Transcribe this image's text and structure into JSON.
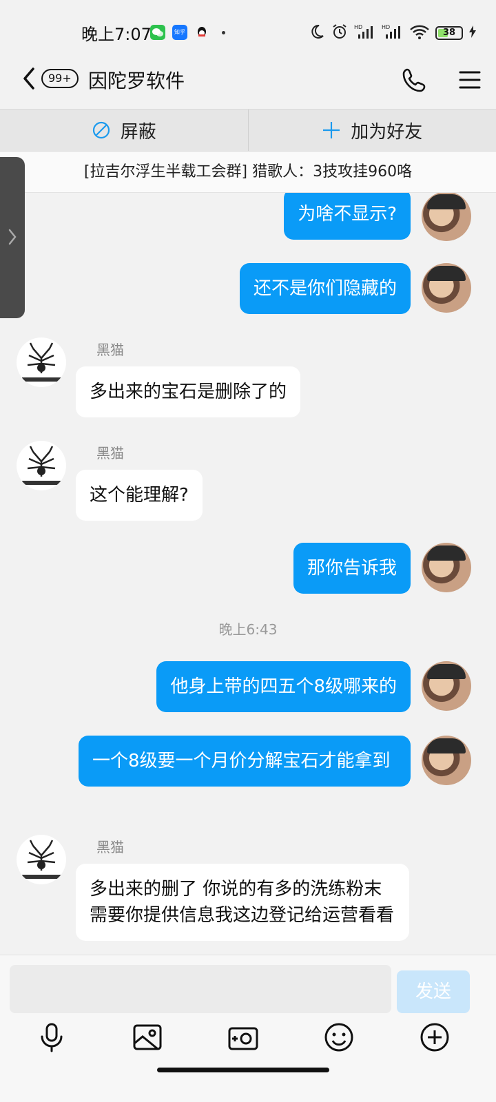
{
  "status": {
    "time": "晚上7:07",
    "apps": {
      "zhihu": "知乎"
    },
    "battery": "38"
  },
  "header": {
    "unread_badge": "99+",
    "title": "因陀罗软件"
  },
  "actions": {
    "block": "屏蔽",
    "add_friend": "加为好友"
  },
  "notice": "[拉吉尔浮生半载工会群] 猎歌人：3技攻挂960咯",
  "messages": [
    {
      "dir": "out",
      "text": "为啥不显示?"
    },
    {
      "dir": "out",
      "text": "还不是你们隐藏的"
    },
    {
      "dir": "in",
      "sender": "黑猫",
      "text": "多出来的宝石是删除了的"
    },
    {
      "dir": "in",
      "sender": "黑猫",
      "text": "这个能理解?"
    },
    {
      "dir": "out",
      "text": "那你告诉我"
    },
    {
      "dir": "time",
      "text": "晚上6:43"
    },
    {
      "dir": "out",
      "text": "他身上带的四五个8级哪来的"
    },
    {
      "dir": "out",
      "text": "一个8级要一个月价分解宝石才能拿到"
    },
    {
      "dir": "in",
      "sender": "黑猫",
      "text": "多出来的删了  你说的有多的洗练粉末  需要你提供信息我这边登记给运营看看"
    }
  ],
  "input": {
    "placeholder": "",
    "send_label": "发送"
  },
  "colors": {
    "outgoing_bubble": "#0a9bf7",
    "incoming_bubble": "#ffffff",
    "accent": "#1b9aee"
  }
}
